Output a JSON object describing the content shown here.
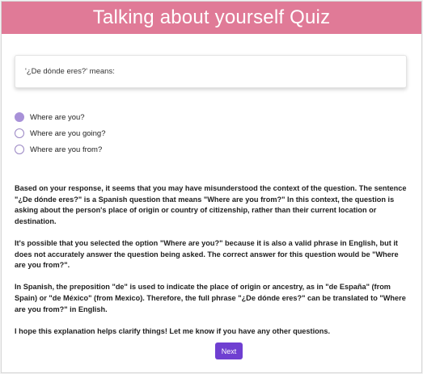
{
  "header": {
    "title": "Talking about yourself Quiz"
  },
  "question": {
    "text": "'¿De dónde eres?' means:"
  },
  "options": [
    {
      "label": "Where are you?",
      "selected": true
    },
    {
      "label": "Where are you going?",
      "selected": false
    },
    {
      "label": "Where are you from?",
      "selected": false
    }
  ],
  "explanation": [
    "Based on your response, it seems that you may have misunderstood the context of the question. The sentence \"¿De dónde eres?\" is a Spanish question that means \"Where are you from?\" In this context, the question is asking about the person's place of origin or country of citizenship, rather than their current location or destination.",
    "It's possible that you selected the option \"Where are you?\" because it is also a valid phrase in English, but it does not accurately answer the question being asked. The correct answer for this question would be \"Where are you from?\".",
    "In Spanish, the preposition \"de\" is used to indicate the place of origin or ancestry, as in \"de España\" (from Spain) or \"de México\" (from Mexico). Therefore, the full phrase \"¿De dónde eres?\" can be translated to \"Where are you from?\" in English.",
    "I hope this explanation helps clarify things! Let me know if you have any other questions."
  ],
  "buttons": {
    "next_label": "Next"
  },
  "colors": {
    "header_bg": "#e07a97",
    "accent": "#6f3fd1",
    "radio_selected": "#a891d8"
  }
}
